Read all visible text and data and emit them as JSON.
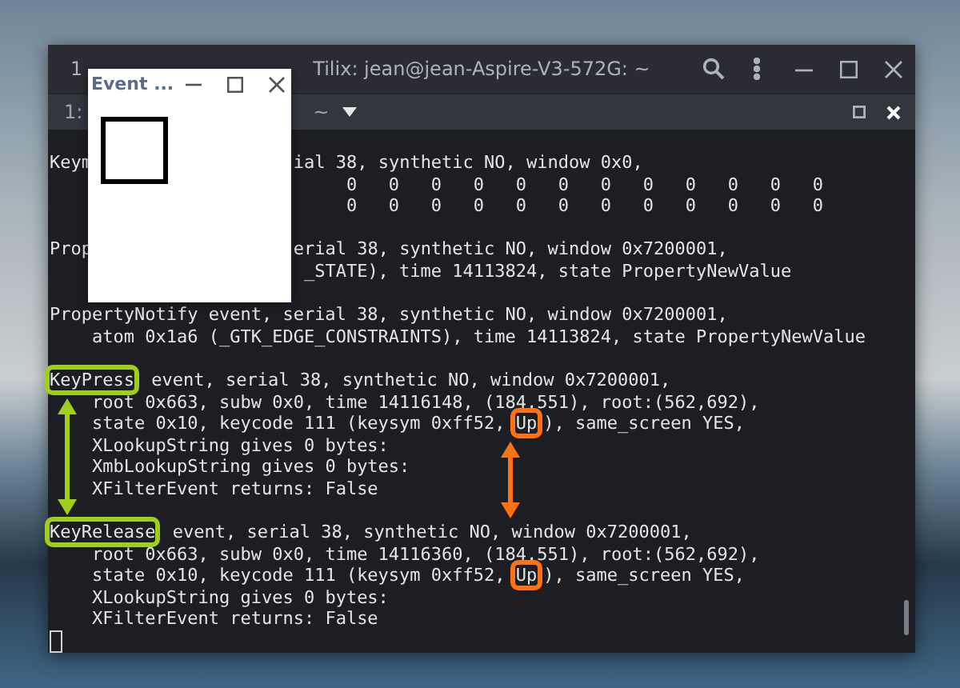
{
  "terminal_window": {
    "session_label": "1",
    "title": "Tilix: jean@jean-Aspire-V3-572G: ~",
    "tab": {
      "label": "1:",
      "path": "~"
    },
    "lines": [
      {
        "kind": "text",
        "segments": [
          {
            "text": "Keym"
          },
          {
            "text": "                   ial 38, synthetic NO, window 0x0,"
          }
        ]
      },
      {
        "kind": "text",
        "segments": [
          {
            "text": "                            0   0   0   0   0   0   0   0   0   0   0   0"
          }
        ]
      },
      {
        "kind": "text",
        "segments": [
          {
            "text": "                            0   0   0   0   0   0   0   0   0   0   0   0"
          }
        ]
      },
      {
        "kind": "blank"
      },
      {
        "kind": "text",
        "segments": [
          {
            "text": "Prop"
          },
          {
            "text": "                   erial 38, synthetic NO, window 0x7200001,"
          }
        ]
      },
      {
        "kind": "text",
        "segments": [
          {
            "text": "                        _STATE), time 14113824, state PropertyNewValue"
          }
        ]
      },
      {
        "kind": "blank"
      },
      {
        "kind": "text",
        "segments": [
          {
            "text": "PropertyNotify event, serial 38, synthetic NO, window 0x7200001,"
          }
        ]
      },
      {
        "kind": "text",
        "segments": [
          {
            "text": "    atom 0x1a6 (_GTK_EDGE_CONSTRAINTS), time 14113824, state PropertyNewValue"
          }
        ]
      },
      {
        "kind": "blank"
      },
      {
        "kind": "text",
        "segments": [
          {
            "text": "KeyPress",
            "color": "#9fcf1a"
          },
          {
            "text": " event, serial 38, synthetic NO, window 0x7200001,"
          }
        ]
      },
      {
        "kind": "text",
        "segments": [
          {
            "text": "    root 0x663, subw 0x0, time 14116148, (184,551), root:(562,692),"
          }
        ]
      },
      {
        "kind": "text",
        "segments": [
          {
            "text": "    state 0x10, keycode 111 (keysym 0xff52, "
          },
          {
            "text": "Up",
            "color": "#ff7212"
          },
          {
            "text": "), same_screen YES,"
          }
        ]
      },
      {
        "kind": "text",
        "segments": [
          {
            "text": "    XLookupString gives 0 bytes:"
          }
        ]
      },
      {
        "kind": "text",
        "segments": [
          {
            "text": "    XmbLookupString gives 0 bytes:"
          }
        ]
      },
      {
        "kind": "text",
        "segments": [
          {
            "text": "    XFilterEvent returns: False"
          }
        ]
      },
      {
        "kind": "blank"
      },
      {
        "kind": "text",
        "segments": [
          {
            "text": "KeyRelease",
            "color": "#9fcf1a"
          },
          {
            "text": " event, serial 38, synthetic NO, window 0x7200001,"
          }
        ]
      },
      {
        "kind": "text",
        "segments": [
          {
            "text": "    root 0x663, subw 0x0, time 14116360, (184,551), root:(562,692),"
          }
        ]
      },
      {
        "kind": "text",
        "segments": [
          {
            "text": "    state 0x10, keycode 111 (keysym 0xff52, "
          },
          {
            "text": "Up",
            "color": "#ff7212"
          },
          {
            "text": "), same_screen YES,"
          }
        ]
      },
      {
        "kind": "text",
        "segments": [
          {
            "text": "    XLookupString gives 0 bytes:"
          }
        ]
      },
      {
        "kind": "text",
        "segments": [
          {
            "text": "    XFilterEvent returns: False"
          }
        ]
      },
      {
        "kind": "cursor"
      }
    ],
    "annotations": [
      {
        "kind": "double-arrow",
        "color": "#9fcf1a"
      },
      {
        "kind": "double-arrow",
        "color": "#ff7212"
      }
    ]
  },
  "event_window": {
    "title": "Event ..."
  }
}
